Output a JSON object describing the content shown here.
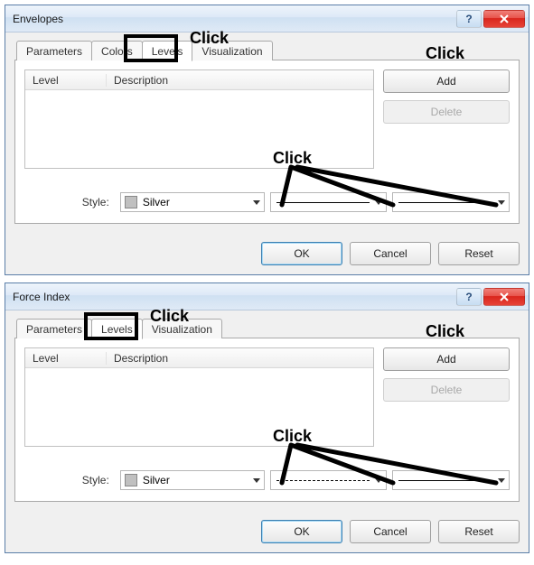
{
  "dialogs": [
    {
      "title": "Envelopes",
      "tabs": [
        "Parameters",
        "Colors",
        "Levels",
        "Visualization"
      ],
      "active_tab_index": 2,
      "annotations": {
        "tab_click": "Click",
        "add_click": "Click",
        "style_click": "Click"
      },
      "list_headers": {
        "level": "Level",
        "description": "Description"
      },
      "side_buttons": {
        "add": "Add",
        "delete": "Delete"
      },
      "style_label": "Style:",
      "color": {
        "name": "Silver",
        "hex": "#c0c0c0"
      },
      "line1": "solid",
      "line2": "thin",
      "footer": {
        "ok": "OK",
        "cancel": "Cancel",
        "reset": "Reset"
      }
    },
    {
      "title": "Force Index",
      "tabs": [
        "Parameters",
        "Levels",
        "Visualization"
      ],
      "active_tab_index": 1,
      "annotations": {
        "tab_click": "Click",
        "add_click": "Click",
        "style_click": "Click"
      },
      "list_headers": {
        "level": "Level",
        "description": "Description"
      },
      "side_buttons": {
        "add": "Add",
        "delete": "Delete"
      },
      "style_label": "Style:",
      "color": {
        "name": "Silver",
        "hex": "#c0c0c0"
      },
      "line1": "dashed",
      "line2": "thin",
      "footer": {
        "ok": "OK",
        "cancel": "Cancel",
        "reset": "Reset"
      }
    }
  ]
}
